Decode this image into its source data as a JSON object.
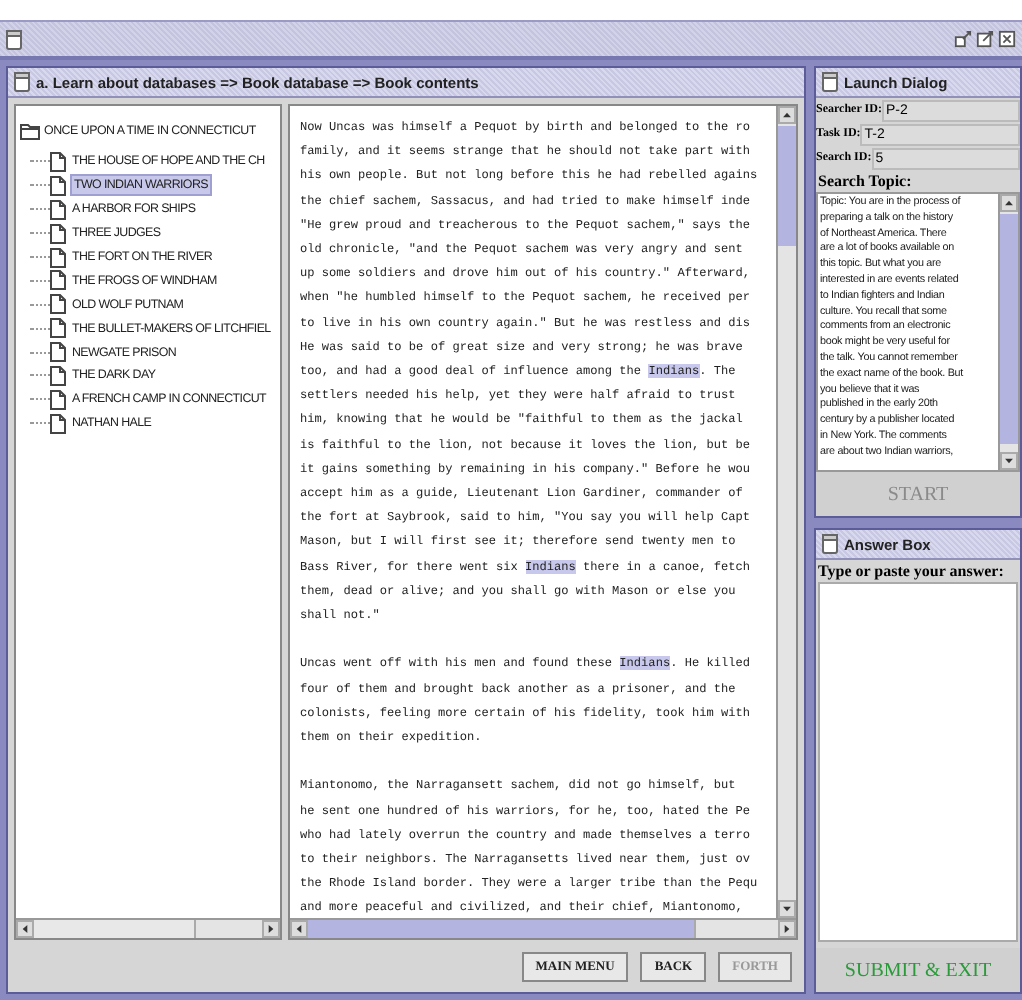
{
  "frame": {
    "title": "a. Learn about databases => Book database => Book contents"
  },
  "tree": {
    "root": {
      "label": "ONCE UPON A TIME IN CONNECTICUT",
      "expanded": true,
      "selected": false,
      "children": [
        {
          "label": "THE HOUSE OF HOPE AND THE CH",
          "selected": false
        },
        {
          "label": "TWO INDIAN WARRIORS",
          "selected": true
        },
        {
          "label": "A HARBOR FOR SHIPS",
          "selected": false
        },
        {
          "label": "THREE JUDGES",
          "selected": false
        },
        {
          "label": "THE FORT ON THE RIVER",
          "selected": false
        },
        {
          "label": "THE FROGS OF WINDHAM",
          "selected": false
        },
        {
          "label": "OLD WOLF PUTNAM",
          "selected": false
        },
        {
          "label": "THE BULLET-MAKERS OF LITCHFIEL",
          "selected": false
        },
        {
          "label": "NEWGATE PRISON",
          "selected": false
        },
        {
          "label": "THE DARK DAY",
          "selected": false
        },
        {
          "label": "A FRENCH CAMP IN CONNECTICUT",
          "selected": false
        },
        {
          "label": "NATHAN HALE",
          "selected": false
        }
      ]
    }
  },
  "book_text": {
    "paragraphs": [
      [
        [
          {
            "text": "Now Uncas was himself a Pequot by birth and belonged to the ro",
            "highlighted": false
          }
        ],
        [
          {
            "text": "family, and it seems strange that he should not take part with",
            "highlighted": false
          }
        ],
        [
          {
            "text": "his own people. But not long before this he had rebelled agains",
            "highlighted": false
          }
        ],
        [
          {
            "text": "the chief sachem, Sassacus, and had tried to make himself inde",
            "highlighted": false
          }
        ],
        [
          {
            "text": "\"He grew proud and treacherous to the Pequot sachem,\" says the",
            "highlighted": false
          }
        ],
        [
          {
            "text": "old chronicle, \"and the Pequot sachem was very angry and sent",
            "highlighted": false
          }
        ],
        [
          {
            "text": "up some soldiers and drove him out of his country.\" Afterward,",
            "highlighted": false
          }
        ],
        [
          {
            "text": "when \"he humbled himself to the Pequot sachem, he received per",
            "highlighted": false
          }
        ],
        [
          {
            "text": "to live in his own country again.\" But he was restless and dis",
            "highlighted": false
          }
        ],
        [
          {
            "text": "He was said to be of great size and very strong; he was brave",
            "highlighted": false
          }
        ],
        [
          {
            "text": "too, and had a good deal of influence among the ",
            "highlighted": false
          },
          {
            "text": "Indians",
            "highlighted": true
          },
          {
            "text": ". The",
            "highlighted": false
          }
        ],
        [
          {
            "text": "settlers needed his help, yet they were half afraid to trust",
            "highlighted": false
          }
        ],
        [
          {
            "text": "him, knowing that he would be \"faithful to them as the jackal",
            "highlighted": false
          }
        ],
        [
          {
            "text": "is faithful to the lion, not because it loves the lion, but be",
            "highlighted": false
          }
        ],
        [
          {
            "text": "it gains something by remaining in his company.\" Before he wou",
            "highlighted": false
          }
        ],
        [
          {
            "text": "accept him as a guide, Lieutenant Lion Gardiner, commander of",
            "highlighted": false
          }
        ],
        [
          {
            "text": "the fort at Saybrook, said to him, \"You say you will help Capt",
            "highlighted": false
          }
        ],
        [
          {
            "text": "Mason, but I will first see it; therefore send twenty men to",
            "highlighted": false
          }
        ],
        [
          {
            "text": "Bass River, for there went six ",
            "highlighted": false
          },
          {
            "text": "Indians",
            "highlighted": true
          },
          {
            "text": " there in a canoe, fetch",
            "highlighted": false
          }
        ],
        [
          {
            "text": "them, dead or alive; and you shall go with Mason or else you",
            "highlighted": false
          }
        ],
        [
          {
            "text": "shall not.\"",
            "highlighted": false
          }
        ]
      ],
      [
        [
          {
            "text": "Uncas went off with his men and found these ",
            "highlighted": false
          },
          {
            "text": "Indians",
            "highlighted": true
          },
          {
            "text": ". He killed",
            "highlighted": false
          }
        ],
        [
          {
            "text": "four of them and brought back another as a prisoner, and the",
            "highlighted": false
          }
        ],
        [
          {
            "text": "colonists, feeling more certain of his fidelity, took him with",
            "highlighted": false
          }
        ],
        [
          {
            "text": "them on their expedition.",
            "highlighted": false
          }
        ]
      ],
      [
        [
          {
            "text": "Miantonomo, the Narragansett sachem, did not go himself, but",
            "highlighted": false
          }
        ],
        [
          {
            "text": "he sent one hundred of his warriors, for he, too, hated the Pe",
            "highlighted": false
          }
        ],
        [
          {
            "text": "who had lately overrun the country and made themselves a terro",
            "highlighted": false
          }
        ],
        [
          {
            "text": "to their neighbors. The Narragansetts lived near them, just ov",
            "highlighted": false
          }
        ],
        [
          {
            "text": "the Rhode Island border. They were a larger tribe than the Pequ",
            "highlighted": false
          }
        ],
        [
          {
            "text": "and more peaceful and civilized, and their chief, Miantonomo,",
            "highlighted": false
          }
        ]
      ]
    ]
  },
  "buttons": [
    {
      "label": "MAIN MENU",
      "disabled": false
    },
    {
      "label": "BACK",
      "disabled": false
    },
    {
      "label": "FORTH",
      "disabled": true
    }
  ],
  "launch_dialog": {
    "title": "Launch Dialog",
    "fields": [
      {
        "label": "Searcher ID:",
        "value": "P-2"
      },
      {
        "label": "Task ID:",
        "value": "T-2"
      },
      {
        "label": "Search ID:",
        "value": "5"
      }
    ],
    "topic_label": "Search Topic:",
    "topic_lines": [
      "Topic: You are in the process of",
      "preparing a talk on the history",
      "of Northeast America. There",
      "are a lot of books available on",
      "this topic. But what you are",
      "interested in are events related",
      "to Indian fighters and Indian",
      "culture.  You recall that some",
      "comments from an electronic",
      "book might be very useful for",
      "the talk. You cannot remember",
      "the exact name of the book. But",
      "you believe that it was",
      "published in the early 20th",
      "century by a publisher located",
      "in New York. The comments",
      "are about two Indian warriors,"
    ],
    "start_button": {
      "label": "START",
      "disabled": true
    }
  },
  "answer_box": {
    "title": "Answer Box",
    "label": "Type or paste your answer:",
    "submit_button": {
      "label": "SUBMIT & EXIT",
      "disabled": false
    }
  }
}
